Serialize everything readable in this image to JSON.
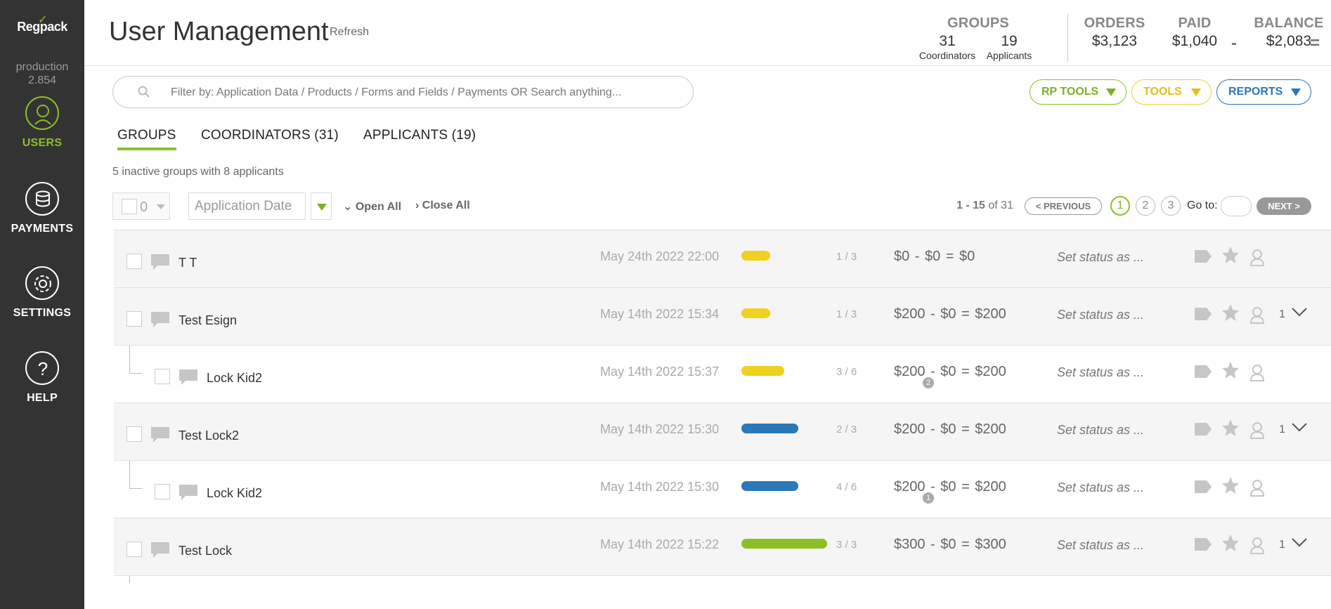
{
  "sidebar": {
    "logo": "Regpack",
    "env_name": "production",
    "env_version": "2.854",
    "items": [
      {
        "label": "USERS",
        "icon": "user-icon",
        "active": true
      },
      {
        "label": "PAYMENTS",
        "icon": "coins-icon"
      },
      {
        "label": "SETTINGS",
        "icon": "gear-icon"
      },
      {
        "label": "HELP",
        "icon": "question-icon"
      }
    ]
  },
  "header": {
    "title": "User Management",
    "refresh": "Refresh",
    "groups": {
      "title": "GROUPS",
      "coordinators_count": "31",
      "coordinators_label": "Coordinators",
      "applicants_count": "19",
      "applicants_label": "Applicants"
    },
    "orders": {
      "title": "ORDERS",
      "value": "$3,123"
    },
    "paid": {
      "title": "PAID",
      "value": "$1,040"
    },
    "balance": {
      "title": "BALANCE",
      "value": "$2,083"
    },
    "minus": "-",
    "equals": "="
  },
  "search": {
    "placeholder": "Filter by: Application Data / Products / Forms and Fields / Payments OR Search anything...",
    "value": ""
  },
  "tools": {
    "rp_tools": "RP TOOLS",
    "tools": "TOOLS",
    "reports": "REPORTS"
  },
  "colors": {
    "accent_green": "#8cbf26",
    "yellow": "#f0d020",
    "blue": "#2a78b8",
    "sidebar_bg": "#333333"
  },
  "tabs": [
    {
      "label": "GROUPS",
      "active": true
    },
    {
      "label": "COORDINATORS (31)"
    },
    {
      "label": "APPLICANTS (19)"
    }
  ],
  "inactive_note": "5 inactive groups with 8 applicants",
  "toolbar": {
    "selected_count": "0",
    "sort_field": "Application Date",
    "open_all": "Open All",
    "close_all": "Close All"
  },
  "pager": {
    "range": "1 - 15",
    "of": "of 31",
    "previous": "< PREVIOUS",
    "pages": [
      "1",
      "2",
      "3"
    ],
    "current_page": "1",
    "goto_label": "Go to:",
    "goto_value": "",
    "next": "NEXT >"
  },
  "rows": [
    {
      "name": "T T",
      "date": "May 24th 2022 22:00",
      "progress_fraction": "1 / 3",
      "progress_color": "#f0d020",
      "money": "$0  -  $0  =  $0",
      "status": "Set status as ...",
      "child_count": "",
      "is_child": false
    },
    {
      "name": "Test Esign",
      "date": "May 14th 2022 15:34",
      "progress_fraction": "1 / 3",
      "progress_color": "#f0d020",
      "money": "$200  -  $0  =  $200",
      "status": "Set status as ...",
      "child_count": "1",
      "is_child": false
    },
    {
      "name": "Lock Kid2",
      "date": "May 14th 2022 15:37",
      "progress_fraction": "3 / 6",
      "progress_color": "#f0d020",
      "money": "$200  -  $0  =  $200",
      "badge": "2",
      "status": "Set status as ...",
      "child_count": "",
      "is_child": true
    },
    {
      "name": "Test Lock2",
      "date": "May 14th 2022 15:30",
      "progress_fraction": "2 / 3",
      "progress_color": "#2a78b8",
      "money": "$200  -  $0  =  $200",
      "status": "Set status as ...",
      "child_count": "1",
      "is_child": false
    },
    {
      "name": "Lock Kid2",
      "date": "May 14th 2022 15:30",
      "progress_fraction": "4 / 6",
      "progress_color": "#2a78b8",
      "money": "$200  -  $0  =  $200",
      "badge": "1",
      "status": "Set status as ...",
      "child_count": "",
      "is_child": true
    },
    {
      "name": "Test Lock",
      "date": "May 14th 2022 15:22",
      "progress_fraction": "3 / 3",
      "progress_color": "#8cbf26",
      "money": "$300  -  $0  =  $300",
      "status": "Set status as ...",
      "child_count": "1",
      "is_child": false
    }
  ]
}
